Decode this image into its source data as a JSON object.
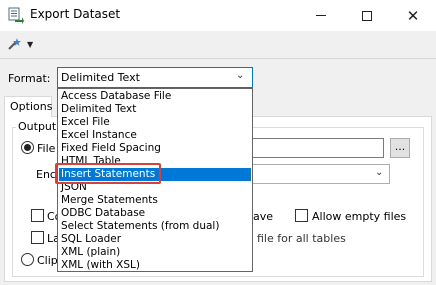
{
  "window": {
    "title": "Export Dataset"
  },
  "format": {
    "label": "Format:",
    "selected": "Delimited Text",
    "options": [
      "Access Database File",
      "Delimited Text",
      "Excel File",
      "Excel Instance",
      "Fixed Field Spacing",
      "HTML Table",
      "Insert Statements",
      "JSON",
      "Merge Statements",
      "ODBC Database",
      "Select Statements (from dual)",
      "SQL Loader",
      "XML (plain)",
      "XML (with XSL)"
    ],
    "highlighted_option": "Insert Statements"
  },
  "tabs": {
    "options_label": "Options"
  },
  "output": {
    "group_label": "Output",
    "file_label_partial": "File",
    "encoding_label_partial": "Enc",
    "co_label_partial": "Co",
    "la_label_partial": "La",
    "clip_label_partial": "Clipb",
    "save_label_partial": "ave",
    "allow_empty_files_label": "Allow empty files",
    "file_for_all_tables_label": "file for all tables",
    "browse_label": "..."
  }
}
